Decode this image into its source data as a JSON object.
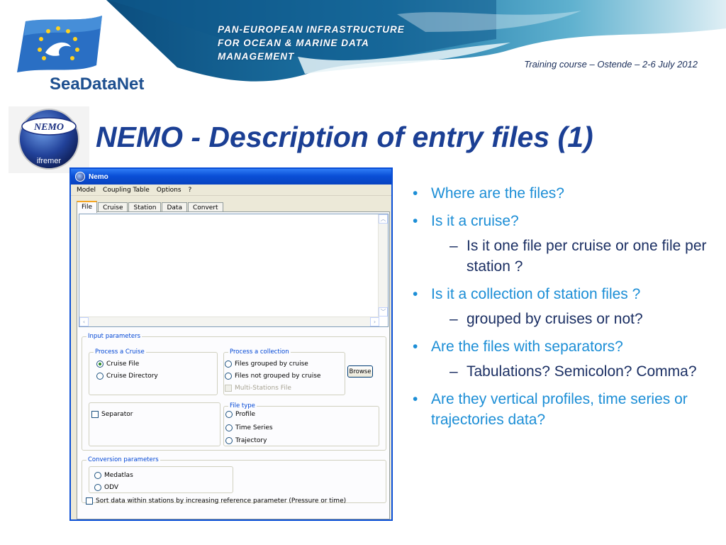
{
  "header": {
    "banner_lines": [
      "PAN-EUROPEAN INFRASTRUCTURE",
      "FOR OCEAN & MARINE DATA",
      "MANAGEMENT"
    ],
    "training_course": "Training course – Ostende – 2-6 July 2012",
    "logo_text": "SeaDataNet",
    "nemo_logo_top": "NEMO",
    "nemo_logo_bottom": "ifremer"
  },
  "slide_title": "NEMO - Description of entry files (1)",
  "bullets": [
    {
      "level": 1,
      "text": "Where are the files?"
    },
    {
      "level": 1,
      "text": "Is it a cruise?"
    },
    {
      "level": 2,
      "text": "Is it one file per cruise or one file per station ?"
    },
    {
      "level": 1,
      "text": "Is it a collection of station files ?"
    },
    {
      "level": 2,
      "text": "grouped by cruises or not?"
    },
    {
      "level": 1,
      "text": "Are the files with separators?"
    },
    {
      "level": 2,
      "text": "Tabulations? Semicolon? Comma?"
    },
    {
      "level": 1,
      "text": "Are they vertical profiles, time series or trajectories data?"
    }
  ],
  "window": {
    "title": "Nemo",
    "menu": [
      "Model",
      "Coupling Table",
      "Options",
      "?"
    ],
    "tabs": [
      "File",
      "Cruise",
      "Station",
      "Data",
      "Convert"
    ],
    "active_tab": "File",
    "input_parameters": {
      "legend": "Input parameters",
      "process_cruise": {
        "legend": "Process a Cruise",
        "options": [
          "Cruise File",
          "Cruise Directory"
        ],
        "selected": "Cruise File"
      },
      "process_collection": {
        "legend": "Process a collection",
        "options": [
          "Files grouped by cruise",
          "Files not grouped by cruise"
        ],
        "multi_stations": "Multi-Stations File"
      },
      "browse_label": "Browse",
      "separator_label": "Separator",
      "file_type": {
        "legend": "File type",
        "options": [
          "Profile",
          "Time Series",
          "Trajectory"
        ]
      }
    },
    "conversion_parameters": {
      "legend": "Conversion parameters",
      "options": [
        "Medatlas",
        "ODV"
      ],
      "sort_label": "Sort data within stations by increasing reference parameter (Pressure or time)"
    }
  },
  "colors": {
    "title_blue": "#1b3f94",
    "bullet_cyan": "#1c8ed6",
    "sub_bullet_navy": "#1b2f63",
    "xp_title_blue": "#0a4fd6",
    "xp_legend_blue": "#0046d5"
  }
}
